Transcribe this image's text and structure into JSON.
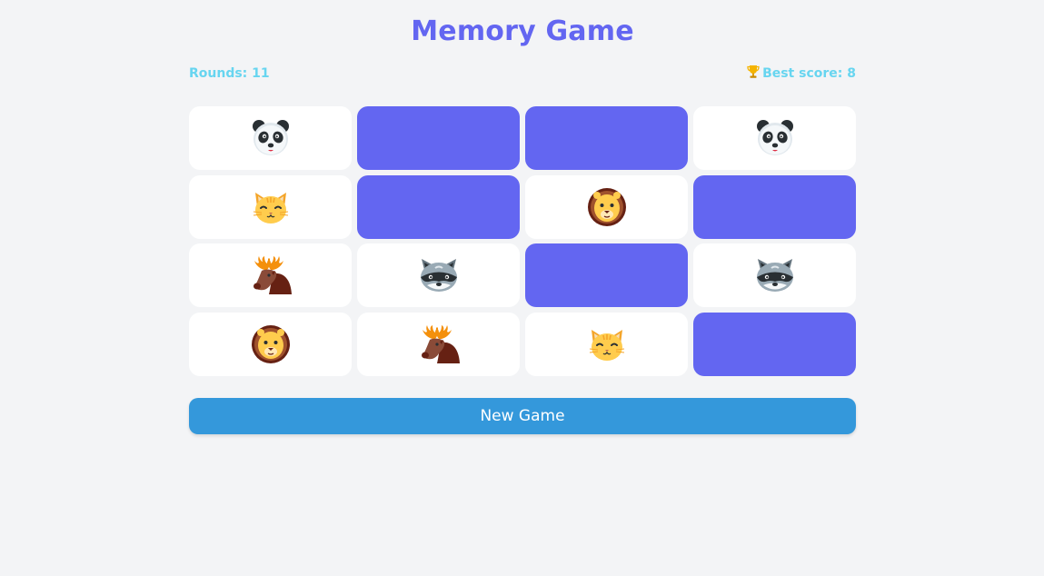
{
  "title": "Memory Game",
  "stats": {
    "rounds_label": "Rounds: 11",
    "best_label": "Best score: 8",
    "trophy_icon": "trophy-icon"
  },
  "colors": {
    "accent": "#6366f1",
    "stat_text": "#67d5f0",
    "button": "#3498db",
    "background": "#f3f4f6",
    "card_face": "#ffffff"
  },
  "cards": [
    {
      "state": "revealed",
      "icon": "panda-icon"
    },
    {
      "state": "hidden",
      "icon": ""
    },
    {
      "state": "hidden",
      "icon": ""
    },
    {
      "state": "revealed",
      "icon": "panda-icon"
    },
    {
      "state": "revealed",
      "icon": "cat-icon"
    },
    {
      "state": "hidden",
      "icon": ""
    },
    {
      "state": "revealed",
      "icon": "lion-icon"
    },
    {
      "state": "hidden",
      "icon": ""
    },
    {
      "state": "revealed",
      "icon": "moose-icon"
    },
    {
      "state": "revealed",
      "icon": "raccoon-icon"
    },
    {
      "state": "hidden",
      "icon": ""
    },
    {
      "state": "revealed",
      "icon": "raccoon-icon"
    },
    {
      "state": "revealed",
      "icon": "lion-icon"
    },
    {
      "state": "revealed",
      "icon": "moose-icon"
    },
    {
      "state": "revealed",
      "icon": "cat-icon"
    },
    {
      "state": "hidden",
      "icon": ""
    }
  ],
  "new_game_label": "New Game"
}
